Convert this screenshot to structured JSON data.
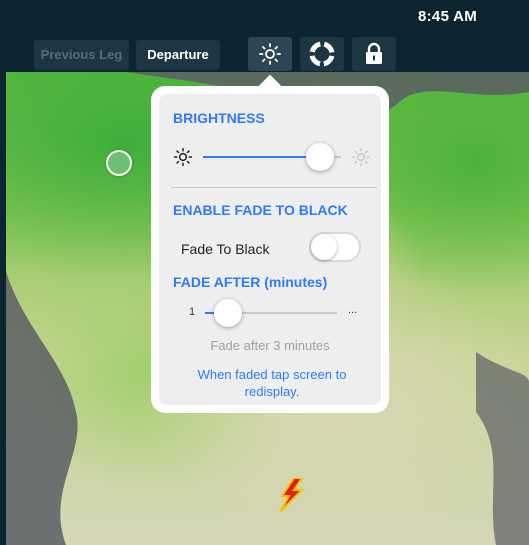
{
  "status_bar": {
    "time": "8:45 AM"
  },
  "toolbar": {
    "previous_leg_label": "Previous Leg",
    "departure_label": "Departure",
    "icons": [
      "brightness-icon",
      "lifebuoy-icon",
      "lock-icon"
    ]
  },
  "popover": {
    "brightness_title": "BRIGHTNESS",
    "brightness_level": 0.85,
    "enable_fade_title": "ENABLE FADE TO BLACK",
    "fade_toggle_label": "Fade To Black",
    "fade_toggle_on": false,
    "fade_after_title": "FADE AFTER (minutes)",
    "fade_slider_min_label": "1",
    "fade_slider_max_label": "...",
    "fade_slider_value": 3,
    "fade_caption": "Fade after 3 minutes",
    "fade_note": "When faded tap screen to redisplay."
  },
  "colors": {
    "accent": "#2e7bf6",
    "toolbar_bg": "#0d2431",
    "popover_bg": "#eeeeee"
  }
}
